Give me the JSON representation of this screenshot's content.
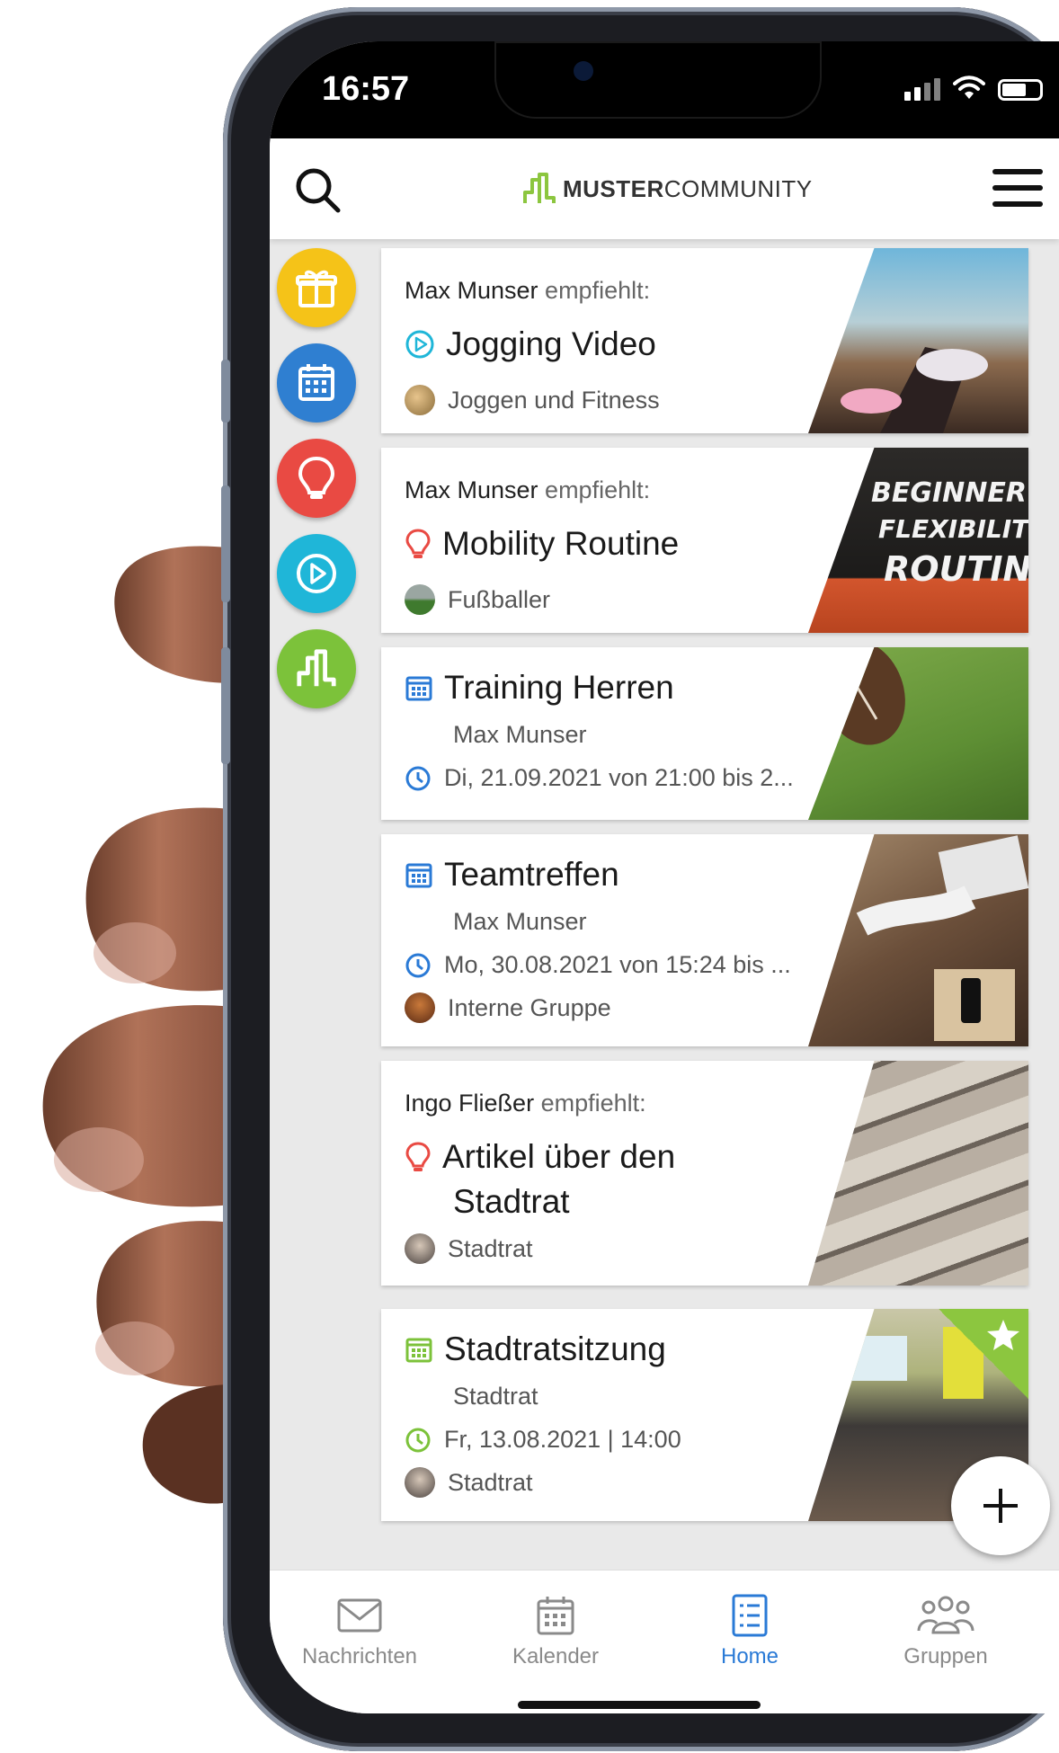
{
  "status_bar": {
    "time": "16:57"
  },
  "header": {
    "logo_bold": "MUSTER",
    "logo_regular": "COMMUNITY",
    "search_icon": "search-icon",
    "menu_icon": "hamburger-menu-icon"
  },
  "quick_actions": [
    {
      "icon": "gift-icon",
      "color": "#f5c318"
    },
    {
      "icon": "calendar-icon",
      "color": "#2f7fd1"
    },
    {
      "icon": "lightbulb-icon",
      "color": "#e94a43"
    },
    {
      "icon": "play-icon",
      "color": "#1fb6d8"
    },
    {
      "icon": "community-logo-icon",
      "color": "#7cc23a"
    }
  ],
  "feed": [
    {
      "recommender": "Max Munser",
      "recommender_suffix": " empfiehlt:",
      "type_icon": "play-circle-icon",
      "title": "Jogging Video",
      "group": "Joggen und Fitness"
    },
    {
      "recommender": "Max Munser",
      "recommender_suffix": " empfiehlt:",
      "type_icon": "lightbulb-icon",
      "title": "Mobility Routine",
      "group": "Fußballer"
    },
    {
      "type_icon": "calendar-icon",
      "title": "Training Herren",
      "organizer": "Max Munser",
      "time": "Di, 21.09.2021 von 21:00 bis 2..."
    },
    {
      "type_icon": "calendar-icon",
      "title": "Teamtreffen",
      "organizer": "Max Munser",
      "time": "Mo, 30.08.2021 von 15:24 bis ...",
      "group": "Interne Gruppe"
    },
    {
      "recommender": "Ingo Fließer",
      "recommender_suffix": " empfiehlt:",
      "type_icon": "lightbulb-icon",
      "title_line1": "Artikel über den",
      "title_line2": "Stadtrat",
      "group": "Stadtrat"
    },
    {
      "type_icon": "calendar-icon",
      "title": "Stadtratsitzung",
      "organizer": "Stadtrat",
      "time": "Fr, 13.08.2021 | 14:00",
      "group": "Stadtrat"
    }
  ],
  "fab": {
    "icon": "plus-icon"
  },
  "tabs": [
    {
      "label": "Nachrichten",
      "icon": "mail-icon",
      "active": false
    },
    {
      "label": "Kalender",
      "icon": "calendar-icon",
      "active": false
    },
    {
      "label": "Home",
      "icon": "list-icon",
      "active": true
    },
    {
      "label": "Gruppen",
      "icon": "users-icon",
      "active": false
    }
  ],
  "colors": {
    "accent_blue": "#2a7ad6",
    "brand_green": "#8cc63f",
    "idea_red": "#e94a43",
    "video_cyan": "#1fb6d8"
  }
}
